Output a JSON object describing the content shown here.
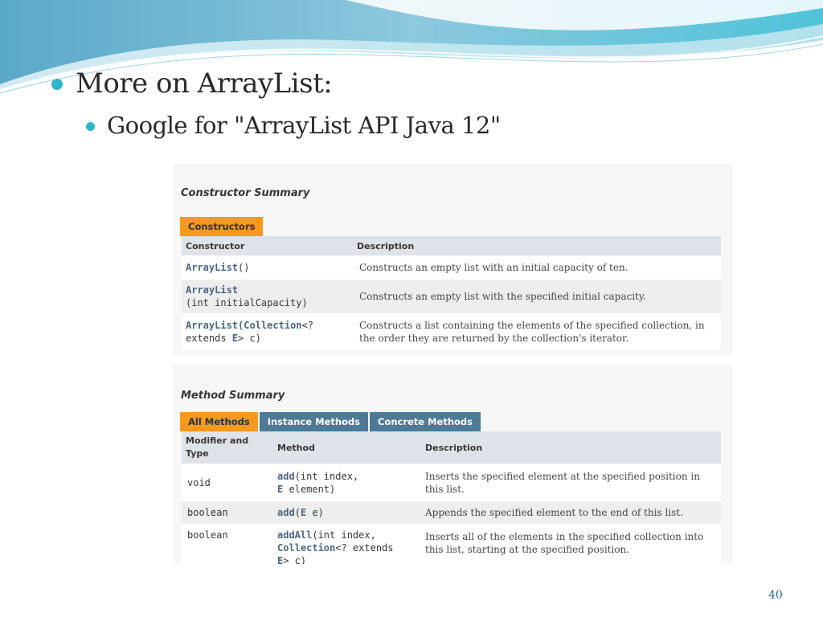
{
  "slide": {
    "bullet_main": "More on ArrayList:",
    "bullet_sub": "Google for \"ArrayList API Java 12\"",
    "page_number": "40"
  },
  "constructor_summary": {
    "title": "Constructor Summary",
    "tab": "Constructors",
    "headers": [
      "Constructor",
      "Description"
    ],
    "rows": [
      {
        "name": "ArrayList",
        "params": "()",
        "description": "Constructs an empty list with an initial capacity of ten."
      },
      {
        "name": "ArrayList",
        "params": "(int initialCapacity)",
        "description": "Constructs an empty list with the specified initial capacity."
      },
      {
        "name": "ArrayList",
        "paren_open": "(",
        "param_type": "Collection",
        "param_rest_line1": "<?",
        "param_rest_line2": "extends ",
        "param_type2": "E",
        "param_end": "> c)",
        "description": "Constructs a list containing the elements of the specified collection, in the order they are returned by the collection's iterator."
      }
    ]
  },
  "method_summary": {
    "title": "Method Summary",
    "tabs": [
      "All Methods",
      "Instance Methods",
      "Concrete Methods"
    ],
    "headers": [
      "Modifier and Type",
      "Method",
      "Description"
    ],
    "rows": [
      {
        "type": "void",
        "method": "add",
        "sig1": "(int index,",
        "sig2_type": "E",
        "sig2_rest": " element)",
        "description": "Inserts the specified element at the specified position in this list."
      },
      {
        "type": "boolean",
        "method": "add",
        "sig_open": "(",
        "sig_type": "E",
        "sig_rest": " e)",
        "description": "Appends the specified element to the end of this list."
      },
      {
        "type": "boolean",
        "method": "addAll",
        "sig1": "(int index,",
        "sig2_type": "Collection",
        "sig2_rest": "<? extends",
        "sig3_type": "E",
        "sig3_rest": "> c)",
        "description": "Inserts all of the elements in the specified collection into this list, starting at the specified position."
      }
    ]
  },
  "colors": {
    "accent_teal": "#31b6c8",
    "tab_active": "#f8981d",
    "tab_inactive": "#4d7a97",
    "link": "#4a6782"
  }
}
